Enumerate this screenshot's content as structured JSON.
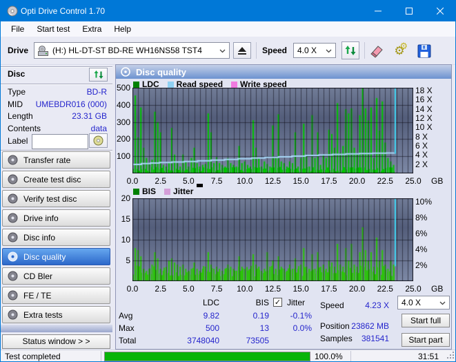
{
  "window": {
    "title": "Opti Drive Control 1.70"
  },
  "menu": {
    "items": [
      "File",
      "Start test",
      "Extra",
      "Help"
    ]
  },
  "toolbar": {
    "drive_label": "Drive",
    "drive_value": "(H:)   HL-DT-ST BD-RE   WH16NS58 TST4",
    "speed_label": "Speed",
    "speed_value": "4.0 X"
  },
  "sidebar": {
    "disc_title": "Disc",
    "disc_rows": [
      {
        "label": "Type",
        "value": "BD-R"
      },
      {
        "label": "MID",
        "value": "UMEBDR016 (000)"
      },
      {
        "label": "Length",
        "value": "23.31 GB"
      },
      {
        "label": "Contents",
        "value": "data"
      }
    ],
    "label_field": {
      "label": "Label",
      "value": ""
    },
    "nav": [
      {
        "label": "Transfer rate",
        "active": false
      },
      {
        "label": "Create test disc",
        "active": false
      },
      {
        "label": "Verify test disc",
        "active": false
      },
      {
        "label": "Drive info",
        "active": false
      },
      {
        "label": "Disc info",
        "active": false
      },
      {
        "label": "Disc quality",
        "active": true
      },
      {
        "label": "CD Bler",
        "active": false
      },
      {
        "label": "FE / TE",
        "active": false
      },
      {
        "label": "Extra tests",
        "active": false
      }
    ],
    "status_window_label": "Status window > >"
  },
  "main": {
    "header": "Disc quality"
  },
  "stats": {
    "columns": [
      "LDC",
      "BIS"
    ],
    "jitter_label": "Jitter",
    "jitter_checked": true,
    "rows": [
      {
        "label": "Avg",
        "ldc": "9.82",
        "bis": "0.19",
        "jitter": "-0.1%"
      },
      {
        "label": "Max",
        "ldc": "500",
        "bis": "13",
        "jitter": "0.0%"
      },
      {
        "label": "Total",
        "ldc": "3748040",
        "bis": "73505",
        "jitter": ""
      }
    ],
    "speed": {
      "label": "Speed",
      "value": "4.23 X"
    },
    "position": {
      "label": "Position",
      "value": "23862 MB"
    },
    "samples": {
      "label": "Samples",
      "value": "381541"
    }
  },
  "controls": {
    "speed_select": "4.0 X",
    "start_full": "Start full",
    "start_part": "Start part"
  },
  "statusbar": {
    "status": "Test completed",
    "percent": "100.0%",
    "time": "31:51",
    "progress_fraction": 1.0
  },
  "colors": {
    "accent": "#0078d7",
    "value_text": "#2424cc",
    "bar_green": "#00c400",
    "read_speed_line": "#a8d8f8",
    "cursor": "#3fd4f2"
  },
  "chart_data": [
    {
      "type": "bar",
      "title": "LDC / Read speed / Write speed vs disc position",
      "legend": [
        {
          "label": "LDC",
          "color": "#008000"
        },
        {
          "label": "Read speed",
          "color": "#8fd0f2"
        },
        {
          "label": "Write speed",
          "color": "#f07ae0"
        }
      ],
      "x_max": 25,
      "x_minor": 0.5,
      "data_end": 23.3,
      "xlabel_unit": "GB",
      "x_ticks": [
        [
          0,
          "0.0"
        ],
        [
          2.5,
          "2.5"
        ],
        [
          5,
          "5.0"
        ],
        [
          7.5,
          "7.5"
        ],
        [
          10,
          "10.0"
        ],
        [
          12.5,
          "12.5"
        ],
        [
          15,
          "15.0"
        ],
        [
          17.5,
          "17.5"
        ],
        [
          20,
          "20.0"
        ],
        [
          22.5,
          "22.5"
        ],
        [
          25,
          "25.0"
        ]
      ],
      "y_max": 500,
      "y_grid": [
        100,
        200,
        300,
        400
      ],
      "y_left_ticks": [
        [
          500,
          "500"
        ],
        [
          400,
          "400"
        ],
        [
          300,
          "300"
        ],
        [
          200,
          "200"
        ],
        [
          100,
          "100"
        ]
      ],
      "y_right_max": 18.6,
      "y_right_ticks": [
        [
          18,
          "18 X"
        ],
        [
          16,
          "16 X"
        ],
        [
          14,
          "14 X"
        ],
        [
          12,
          "12 X"
        ],
        [
          10,
          "10 X"
        ],
        [
          8,
          "8 X"
        ],
        [
          6,
          "6 X"
        ],
        [
          4,
          "4 X"
        ],
        [
          2,
          "2 X"
        ]
      ],
      "bar_color": "#00c400",
      "bar_step": 0.25,
      "baseline": 26,
      "seed": 3,
      "bars": [
        40,
        455,
        210,
        385,
        150,
        90,
        60,
        80,
        360,
        300,
        240,
        50,
        40,
        60,
        265,
        110,
        60,
        40,
        110,
        65,
        40,
        90,
        150,
        60,
        40,
        50,
        55,
        350,
        240,
        60,
        95,
        60,
        50,
        40,
        90,
        60,
        50,
        40,
        160,
        60,
        70,
        50,
        40,
        310,
        150,
        90,
        40,
        70,
        55,
        40,
        280,
        90,
        345,
        70,
        60,
        40,
        70,
        60,
        240,
        40,
        90,
        290,
        110,
        40,
        340,
        90,
        240,
        50,
        110,
        90,
        255,
        230,
        150,
        410,
        120,
        160,
        375,
        350,
        380,
        150,
        110,
        340,
        500,
        380,
        310,
        385,
        90,
        440,
        250,
        420,
        180,
        90,
        70,
        50
      ],
      "line_color": "#a8d8f8",
      "line_points": [
        [
          0,
          52
        ],
        [
          0.8,
          57
        ],
        [
          1.6,
          60
        ],
        [
          2.4,
          64
        ],
        [
          3.5,
          67
        ],
        [
          4.6,
          70
        ],
        [
          5.8,
          74
        ],
        [
          7,
          78
        ],
        [
          8.2,
          82
        ],
        [
          9.4,
          86
        ],
        [
          10.6,
          90
        ],
        [
          11.8,
          94
        ],
        [
          13,
          97
        ],
        [
          14.2,
          101
        ],
        [
          15.4,
          105
        ],
        [
          16.6,
          108
        ],
        [
          17.8,
          111
        ],
        [
          19,
          114
        ],
        [
          20.2,
          116
        ],
        [
          21.4,
          118
        ],
        [
          22.6,
          119
        ],
        [
          23.3,
          120
        ]
      ],
      "cursor_x": 23.4,
      "cursor_to": 0.77,
      "cursor_color": "#3fd4f2"
    },
    {
      "type": "bar",
      "title": "BIS / Jitter vs disc position",
      "legend": [
        {
          "label": "BIS",
          "color": "#008000"
        },
        {
          "label": "Jitter",
          "color": "#d49ed8"
        }
      ],
      "x_max": 25,
      "x_minor": 0.5,
      "data_end": 23.3,
      "xlabel_unit": "GB",
      "x_ticks": [
        [
          0,
          "0.0"
        ],
        [
          2.5,
          "2.5"
        ],
        [
          5,
          "5.0"
        ],
        [
          7.5,
          "7.5"
        ],
        [
          10,
          "10.0"
        ],
        [
          12.5,
          "12.5"
        ],
        [
          15,
          "15.0"
        ],
        [
          17.5,
          "17.5"
        ],
        [
          20,
          "20.0"
        ],
        [
          22.5,
          "22.5"
        ],
        [
          25,
          "25.0"
        ]
      ],
      "y_max": 20,
      "y_grid": [
        5,
        10,
        15
      ],
      "y_left_ticks": [
        [
          20,
          "20"
        ],
        [
          15,
          "15"
        ],
        [
          10,
          "10"
        ],
        [
          5,
          "5"
        ]
      ],
      "y_right_max": 10.4,
      "y_right_ticks": [
        [
          10,
          "10%"
        ],
        [
          8,
          "8%"
        ],
        [
          6,
          "6%"
        ],
        [
          4,
          "4%"
        ],
        [
          2,
          "2%"
        ]
      ],
      "bar_color": "#2cc40a",
      "bar_step": 0.25,
      "baseline": 2.6,
      "seed": 7,
      "bars": [
        3,
        8,
        7.5,
        6,
        3,
        2.5,
        3,
        4,
        7,
        5.5,
        3,
        2.5,
        3,
        5,
        5.5,
        4.5,
        4,
        3.5,
        4,
        3,
        2.5,
        3,
        4.5,
        3,
        2.5,
        3,
        3.5,
        7,
        4,
        3,
        3.5,
        3,
        2.5,
        3,
        4,
        3.5,
        3,
        2.5,
        6,
        3.5,
        3,
        2.5,
        3,
        6.5,
        4,
        3.5,
        2.5,
        3,
        7,
        3.5,
        5,
        3,
        6,
        3.5,
        3,
        2.5,
        4,
        3,
        5.5,
        3,
        4,
        8,
        3.5,
        3,
        6.5,
        3,
        7,
        3.5,
        4,
        3,
        5,
        4.5,
        3.5,
        9,
        4,
        3.5,
        8,
        5,
        9,
        4,
        3.5,
        7,
        13,
        7.5,
        5,
        7,
        3.5,
        10.5,
        5,
        7.5,
        4,
        3,
        5,
        4
      ],
      "cursor_x": 23.4,
      "cursor_to": 0.82,
      "cursor_color": "#3fd4f2"
    }
  ]
}
